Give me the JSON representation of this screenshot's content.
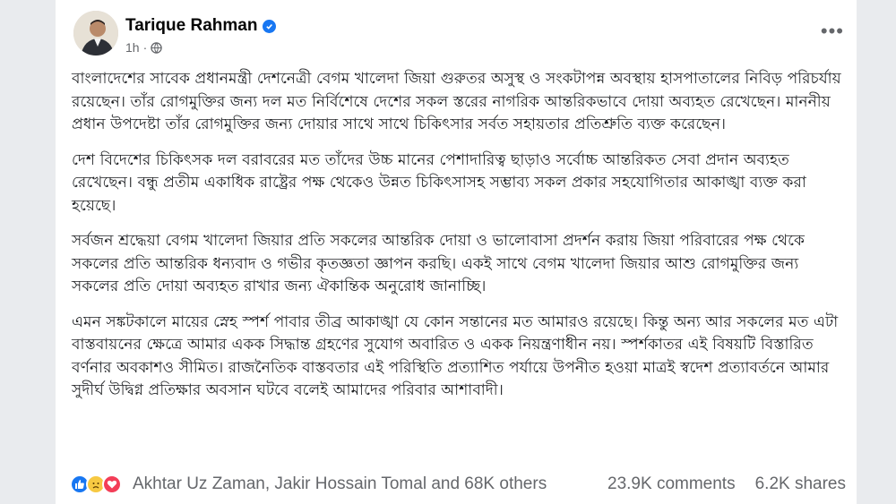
{
  "post": {
    "author": "Tarique Rahman",
    "time": "1h",
    "body": [
      "বাংলাদেশের সাবেক প্রধানমন্ত্রী দেশনেত্রী বেগম খালেদা জিয়া গুরুতর অসুস্থ ও সংকটাপন্ন অবস্থায় হাসপাতালের নিবিড় পরিচর্যায় রয়েছেন। তাঁর রোগমুক্তির জন্য দল মত নির্বিশেষে দেশের সকল স্তরের নাগরিক আন্তরিকভাবে দোয়া অব্যহত রেখেছেন। মাননীয় প্রধান উপদেষ্টা তাঁর রোগমুক্তির জন্য দোয়ার সাথে সাথে চিকিৎসার সর্বত সহায়তার প্রতিশ্রুতি ব্যক্ত করেছেন।",
      "দেশ বিদেশের চিকিৎসক দল বরাবরের মত তাঁদের উচ্চ মানের পেশাদারিত্ব ছাড়াও সর্বোচ্চ আন্তরিকত সেবা প্রদান অব্যহত রেখেছেন। বন্ধু প্রতীম একাধিক রাষ্ট্রের পক্ষ থেকেও উন্নত চিকিৎসাসহ সম্ভাব্য সকল প্রকার সহযোগিতার আকাঙ্খা ব্যক্ত করা হয়েছে।",
      "সর্বজন শ্রদ্ধেয়া বেগম খালেদা জিয়ার প্রতি সকলের আন্তরিক দোয়া ও ভালোবাসা প্রদর্শন করায় জিয়া পরিবারের পক্ষ থেকে সকলের প্রতি আন্তরিক ধন্যবাদ ও গভীর কৃতজ্ঞতা জ্ঞাপন করছি। একই সাথে বেগম খালেদা জিয়ার আশু রোগমুক্তির জন্য সকলের প্রতি দোয়া অব্যহত রাখার জন্য ঐকান্তিক অনুরোধ জানাচ্ছি।",
      "এমন সঙ্কটকালে মায়ের স্নেহ স্পর্শ পাবার তীব্র আকাঙ্খা যে কোন সন্তানের মত আমারও রয়েছে। কিন্তু অন্য আর সকলের মত এটা বাস্তবায়নের ক্ষেত্রে আমার একক সিদ্ধান্ত গ্রহণের সুযোগ অবারিত ও একক নিয়ন্ত্রণাধীন নয়। স্পর্শকাতর এই বিষয়টি বিস্তারিত বর্ণনার অবকাশও সীমিত। রাজনৈতিক বাস্তবতার এই পরিস্থিতি প্রত্যাশিত পর্যায়ে উপনীত হওয়া মাত্রই স্বদেশ প্রত্যাবর্তনে আমার সুদীর্ঘ উদ্বিগ্ন প্রতিক্ষার অবসান ঘটবে বলেই আমাদের পরিবার আশাবাদী।"
    ],
    "reactors": "Akhtar Uz Zaman, Jakir Hossain Tomal and 68K others",
    "comments": "23.9K comments",
    "shares": "6.2K shares",
    "icons": {
      "verified": "verified-badge-icon",
      "audience": "globe-icon",
      "more": "more-options-icon",
      "reactions": [
        "like-icon",
        "sad-icon",
        "love-icon"
      ]
    },
    "colors": {
      "verified": "#1877f2",
      "like": "#1877f2",
      "sad": "#f7c942",
      "love": "#f33e58"
    }
  }
}
